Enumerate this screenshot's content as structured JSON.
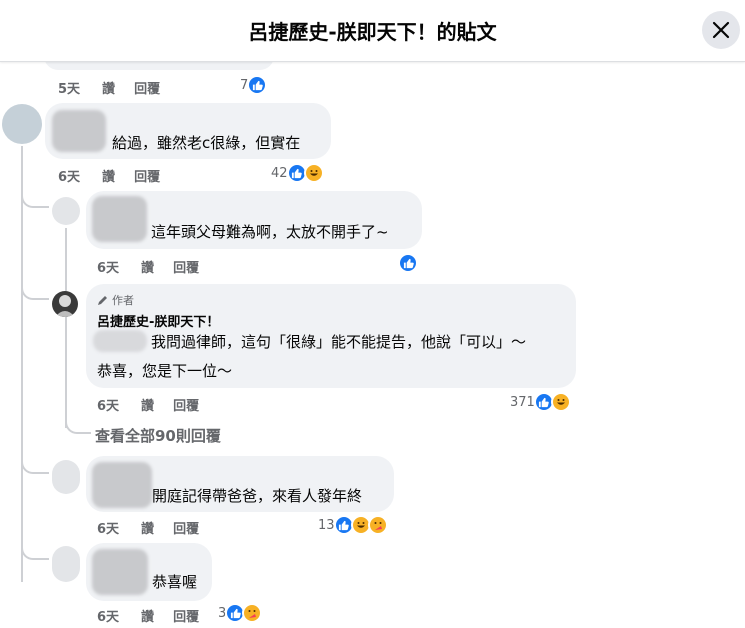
{
  "header": {
    "title": "呂捷歷史-朕即天下！的貼文"
  },
  "comments": [
    {
      "time": "5天",
      "like_label": "讚",
      "reply_label": "回覆",
      "reaction_count": "7"
    },
    {
      "text": "給過，雖然老c很綠，但實在",
      "time": "6天",
      "like_label": "讚",
      "reply_label": "回覆",
      "reaction_count": "42"
    },
    {
      "text": "這年頭父母難為啊，太放不開手了~",
      "time": "6天",
      "like_label": "讚",
      "reply_label": "回覆",
      "reaction_count": ""
    },
    {
      "author_badge": "作者",
      "author": "呂捷歷史-朕即天下！",
      "text_line1": "我問過律師，這句「很綠」能不能提告，他說「可以」～",
      "text_line2": "恭喜，您是下一位～",
      "time": "6天",
      "like_label": "讚",
      "reply_label": "回覆",
      "reaction_count": "371"
    },
    {
      "text": "開庭記得帶爸爸，來看人發年終",
      "time": "6天",
      "like_label": "讚",
      "reply_label": "回覆",
      "reaction_count": "13"
    },
    {
      "text": "恭喜喔",
      "time": "6天",
      "like_label": "讚",
      "reply_label": "回覆",
      "reaction_count": "3"
    }
  ],
  "view_more": "查看全部90則回覆",
  "colors": {
    "like": "#1877f2",
    "haha": "#f7b125",
    "bubble": "#f0f2f5",
    "meta": "#65676b"
  }
}
